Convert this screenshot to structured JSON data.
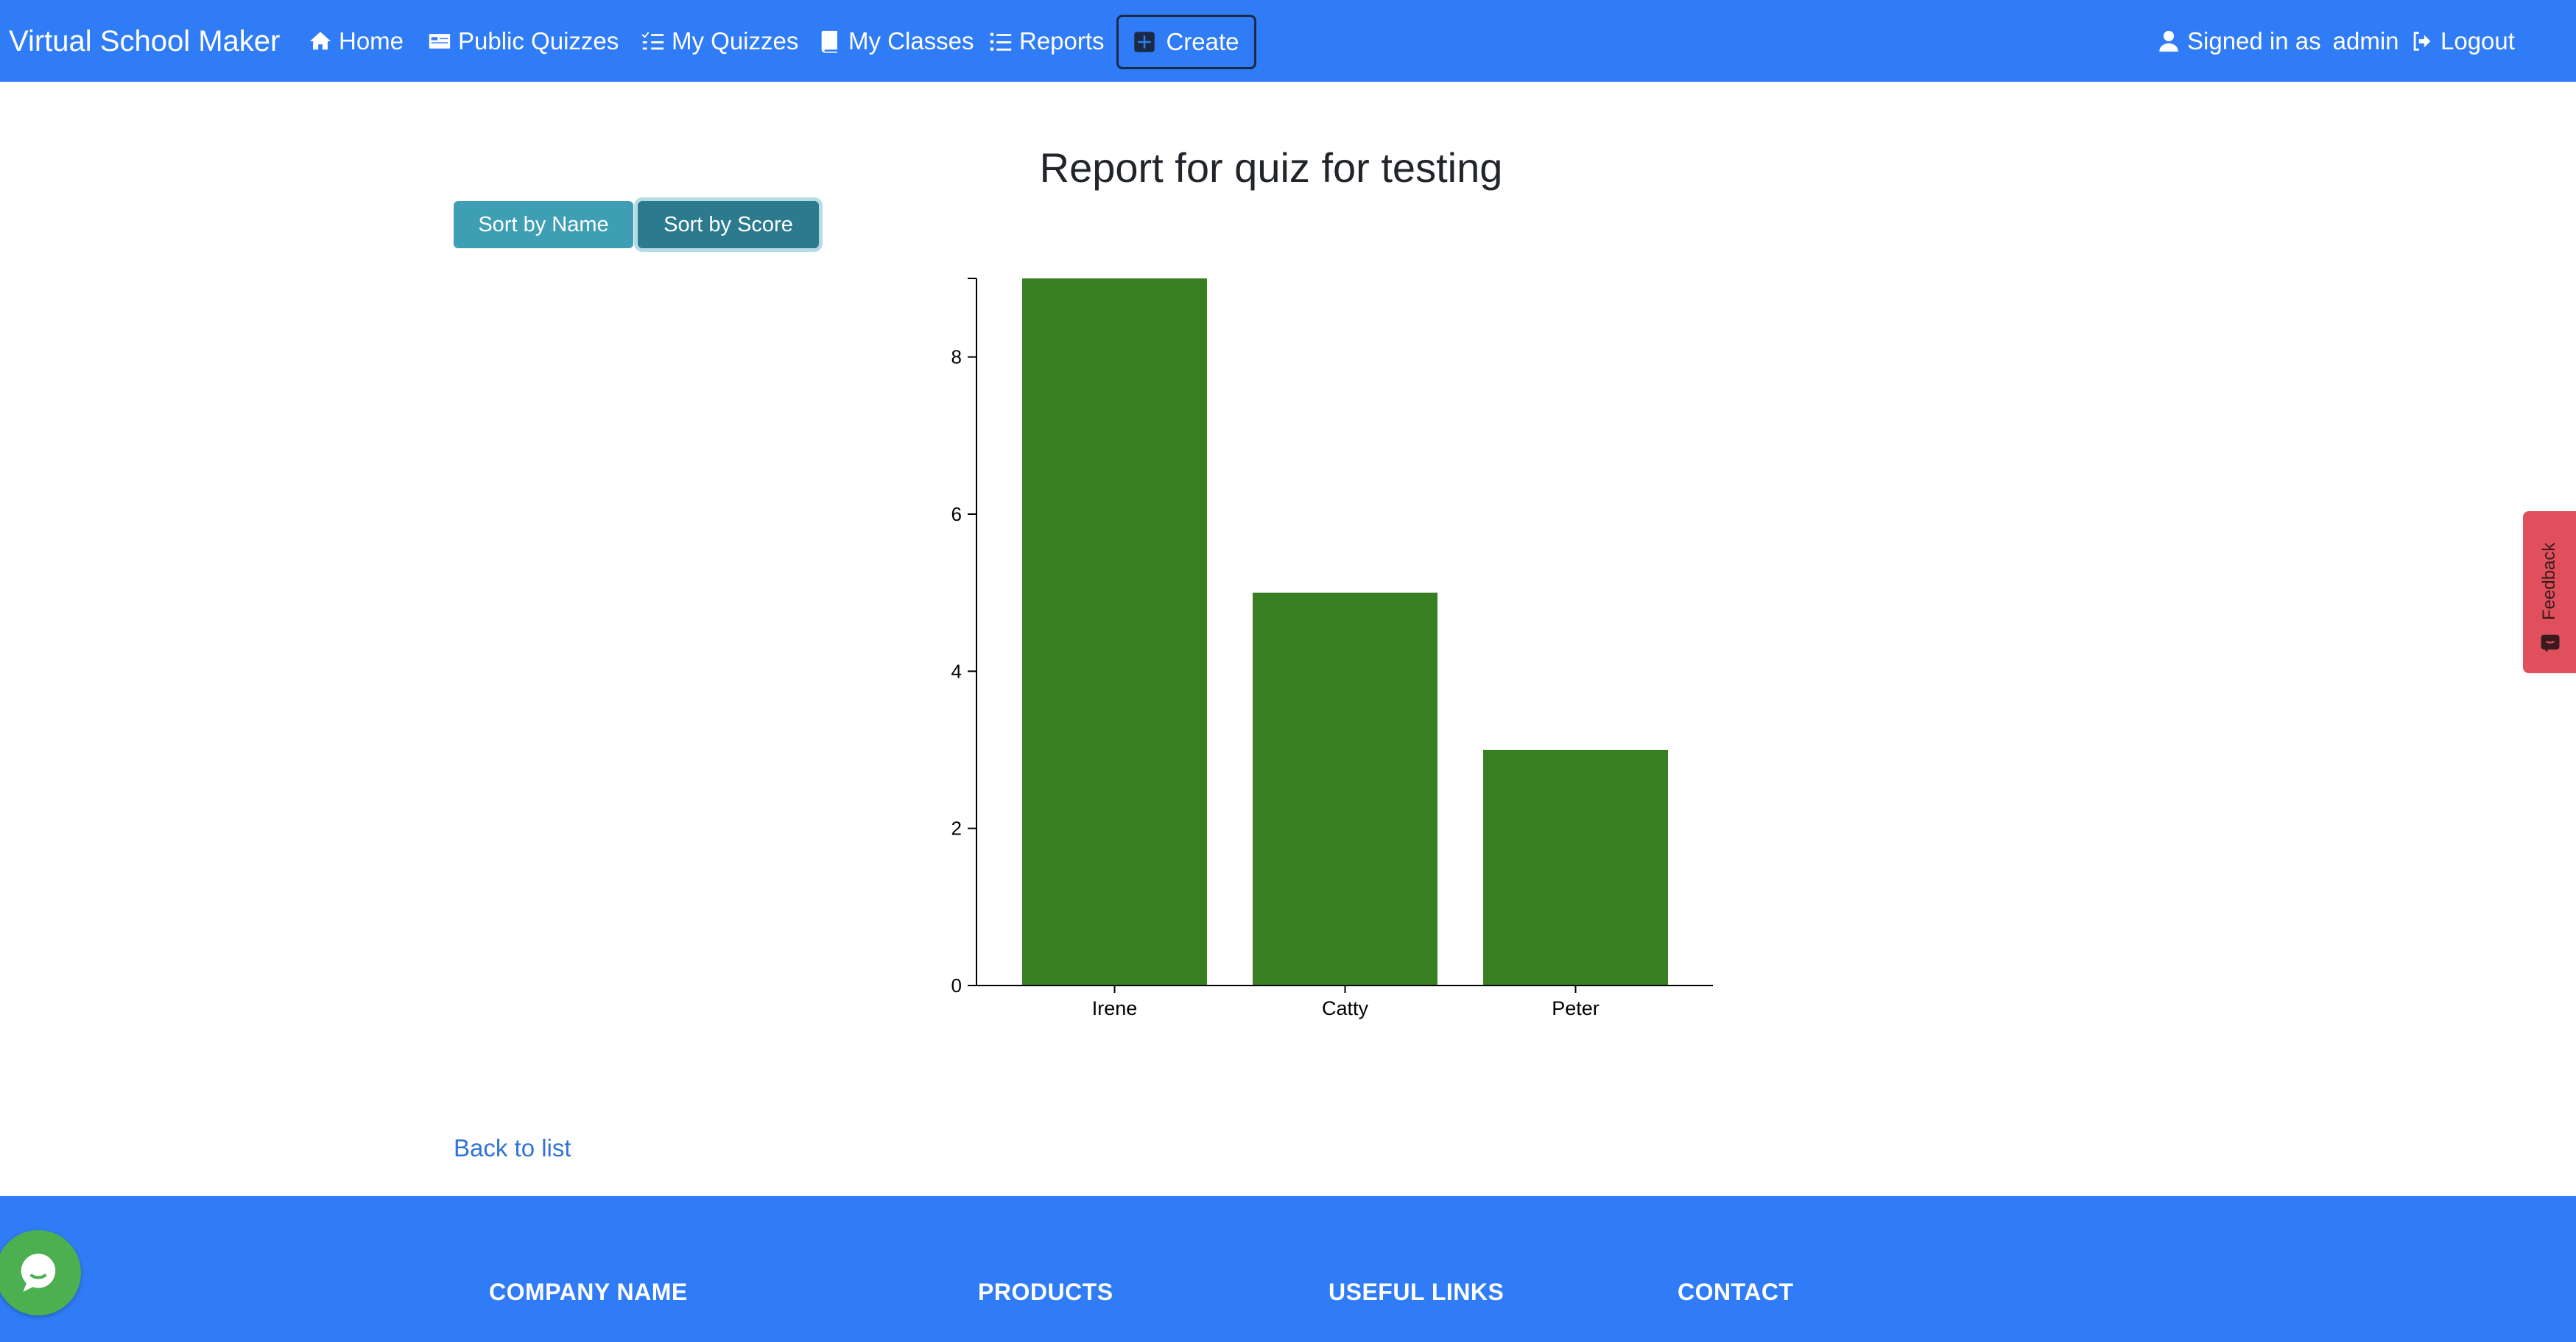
{
  "navbar": {
    "brand": "Virtual School Maker",
    "items": [
      {
        "label": "Home",
        "icon": "home-icon"
      },
      {
        "label": "Public Quizzes",
        "icon": "card-icon"
      },
      {
        "label": "My Quizzes",
        "icon": "checklist-icon"
      },
      {
        "label": "My Classes",
        "icon": "book-icon"
      },
      {
        "label": "Reports",
        "icon": "list-icon"
      }
    ],
    "create_label": "Create",
    "signed_in_label": "Signed in as",
    "username": "admin",
    "logout_label": "Logout"
  },
  "main": {
    "title": "Report for quiz for testing",
    "sort_by_name_label": "Sort by Name",
    "sort_by_score_label": "Sort by Score",
    "back_link": "Back to list"
  },
  "chart_data": {
    "type": "bar",
    "title": "",
    "xlabel": "",
    "ylabel": "",
    "categories": [
      "Irene",
      "Catty",
      "Peter"
    ],
    "values": [
      9,
      5,
      3
    ],
    "ylim": [
      0,
      9
    ],
    "yticks": [
      0,
      2,
      4,
      6,
      8
    ],
    "bar_color": "#387f22",
    "grid": false
  },
  "footer": {
    "headings": [
      "COMPANY NAME",
      "PRODUCTS",
      "USEFUL LINKS",
      "CONTACT"
    ]
  },
  "feedback_tab": {
    "label": "Feedback"
  },
  "colors": {
    "primary": "#307cf6",
    "sort_button": "#3e9eb4",
    "sort_button_active": "#2c7a8e",
    "feedback": "#e0505c",
    "chat": "#4caf50",
    "link": "#2f73d8"
  }
}
